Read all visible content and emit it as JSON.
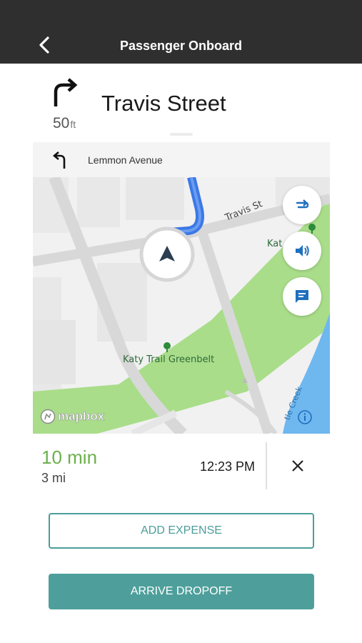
{
  "header": {
    "title": "Passenger Onboard"
  },
  "maneuver": {
    "distance_value": "50",
    "distance_unit": "ft",
    "street": "Travis Street"
  },
  "next_step": {
    "street": "Lemmon Avenue"
  },
  "map": {
    "labels": {
      "travis_st": "Travis St",
      "katy_partial": "Kat",
      "greenbelt": "Katy Trail Greenbelt",
      "creek": "tle Creek"
    },
    "attribution": "mapbox",
    "colors": {
      "route": "#3c78e6",
      "park": "#a9dd8a",
      "water": "#6fb7ef",
      "road": "#d9d9d9",
      "accent": "#1f6fbf"
    },
    "icons": [
      "routes-icon",
      "volume-icon",
      "message-icon",
      "info-icon",
      "navigation-arrow-icon"
    ]
  },
  "eta": {
    "duration": "10 min",
    "distance": "3 mi",
    "arrival_time": "12:23 PM"
  },
  "actions": {
    "add_expense": "ADD EXPENSE",
    "arrive_dropoff": "ARRIVE DROPOFF"
  },
  "theme": {
    "header_bg": "#2f2f2f",
    "teal": "#4e9f9b",
    "eta_green": "#6ab04c"
  }
}
